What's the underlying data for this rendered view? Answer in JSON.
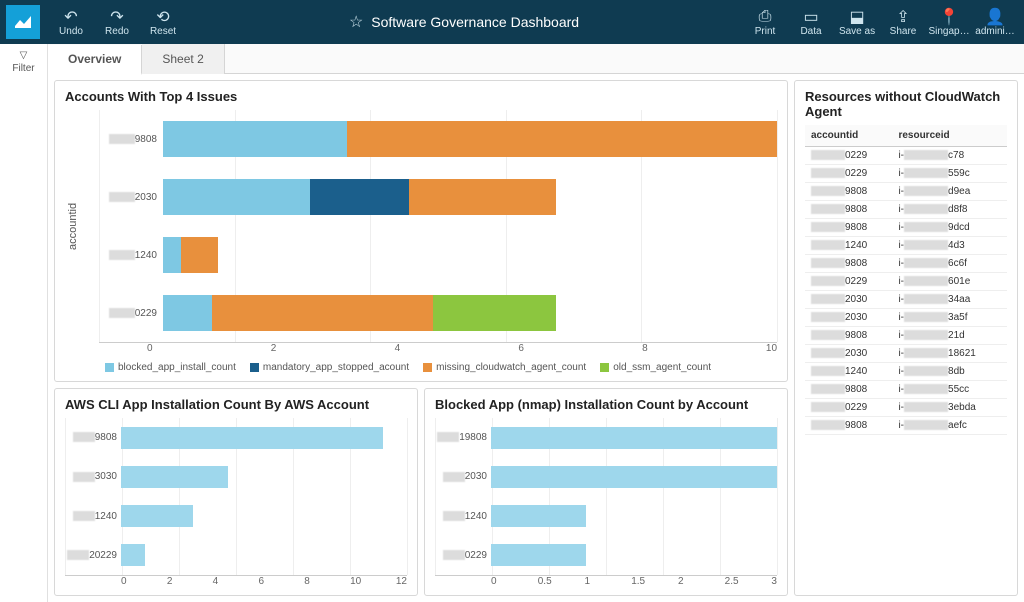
{
  "header": {
    "title": "Software Governance Dashboard",
    "buttons_left": [
      {
        "name": "undo",
        "label": "Undo",
        "icon": "↶"
      },
      {
        "name": "redo",
        "label": "Redo",
        "icon": "↷"
      },
      {
        "name": "reset",
        "label": "Reset",
        "icon": "⟲"
      }
    ],
    "buttons_right": [
      {
        "name": "print",
        "label": "Print",
        "icon": "⎙"
      },
      {
        "name": "data",
        "label": "Data",
        "icon": "▭"
      },
      {
        "name": "saveas",
        "label": "Save as",
        "icon": "⬓"
      },
      {
        "name": "share",
        "label": "Share",
        "icon": "⇪"
      },
      {
        "name": "region",
        "label": "Singap…",
        "icon": "📍"
      },
      {
        "name": "admin",
        "label": "admini…",
        "icon": "👤"
      }
    ]
  },
  "filter_label": "Filter",
  "tabs": [
    {
      "label": "Overview",
      "active": true
    },
    {
      "label": "Sheet 2",
      "active": false
    }
  ],
  "panel_top": {
    "title": "Accounts With Top 4 Issues",
    "ylabel": "accountid",
    "legend": [
      {
        "label": "blocked_app_install_count",
        "color": "c1"
      },
      {
        "label": "mandatory_app_stopped_acount",
        "color": "c2"
      },
      {
        "label": "missing_cloudwatch_agent_count",
        "color": "c3"
      },
      {
        "label": "old_ssm_agent_count",
        "color": "c4"
      }
    ]
  },
  "panel_bl": {
    "title": "AWS CLI App Installation Count By AWS Account"
  },
  "panel_br": {
    "title": "Blocked App (nmap) Installation Count by Account"
  },
  "panel_right": {
    "title": "Resources without CloudWatch Agent",
    "col1": "accountid",
    "col2": "resourceid",
    "rows": [
      {
        "acct": "0229",
        "res": "c78"
      },
      {
        "acct": "0229",
        "res": "559c"
      },
      {
        "acct": "9808",
        "res": "d9ea"
      },
      {
        "acct": "9808",
        "res": "d8f8"
      },
      {
        "acct": "9808",
        "res": "9dcd"
      },
      {
        "acct": "1240",
        "res": "4d3"
      },
      {
        "acct": "9808",
        "res": "6c6f"
      },
      {
        "acct": "0229",
        "res": "601e"
      },
      {
        "acct": "2030",
        "res": "34aa"
      },
      {
        "acct": "2030",
        "res": "3a5f"
      },
      {
        "acct": "9808",
        "res": "21d"
      },
      {
        "acct": "2030",
        "res": "18621"
      },
      {
        "acct": "1240",
        "res": "8db"
      },
      {
        "acct": "9808",
        "res": "55cc"
      },
      {
        "acct": "0229",
        "res": "3ebda"
      },
      {
        "acct": "9808",
        "res": "aefc"
      }
    ]
  },
  "chart_data": [
    {
      "id": "top4",
      "type": "bar",
      "orientation": "horizontal",
      "stacked": true,
      "ylabel": "accountid",
      "xlim": [
        0,
        10
      ],
      "xticks": [
        0,
        2,
        4,
        6,
        8,
        10
      ],
      "categories": [
        "…9808",
        "…2030",
        "…1240",
        "…0229"
      ],
      "series": [
        {
          "name": "blocked_app_install_count",
          "color": "#7ec8e3",
          "values": [
            3,
            3,
            1,
            1
          ]
        },
        {
          "name": "mandatory_app_stopped_acount",
          "color": "#1b5f8c",
          "values": [
            0,
            2,
            0,
            0
          ]
        },
        {
          "name": "missing_cloudwatch_agent_count",
          "color": "#e8903d",
          "values": [
            7,
            3,
            2,
            4.5
          ]
        },
        {
          "name": "old_ssm_agent_count",
          "color": "#8cc63f",
          "values": [
            0,
            0,
            0,
            2.5
          ]
        }
      ]
    },
    {
      "id": "awscli",
      "type": "bar",
      "orientation": "horizontal",
      "xlim": [
        0,
        12
      ],
      "xticks": [
        0,
        2,
        4,
        6,
        8,
        10,
        12
      ],
      "categories": [
        "…9808",
        "…3030",
        "…1240",
        "…20229"
      ],
      "values": [
        11,
        4.5,
        3,
        1
      ],
      "color": "#9ed7ec",
      "title": "AWS CLI App Installation Count By AWS Account"
    },
    {
      "id": "nmap",
      "type": "bar",
      "orientation": "horizontal",
      "xlim": [
        0,
        3
      ],
      "xticks": [
        0,
        0.5,
        1,
        1.5,
        2,
        2.5,
        3
      ],
      "categories": [
        "…19808",
        "…2030",
        "…1240",
        "…0229"
      ],
      "values": [
        3,
        3,
        1,
        1
      ],
      "color": "#9ed7ec",
      "title": "Blocked App (nmap) Installation Count by Account"
    }
  ]
}
